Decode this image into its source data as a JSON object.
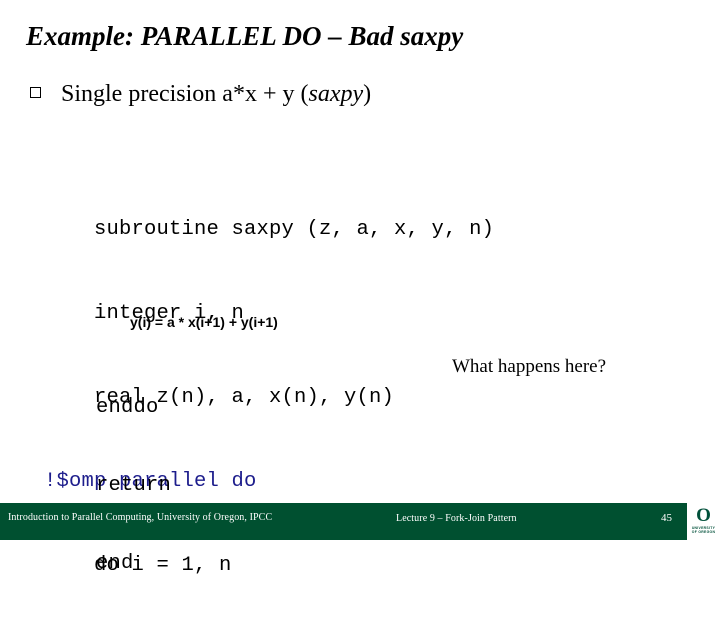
{
  "slide": {
    "title": "Example: PARALLEL DO – Bad saxpy",
    "bullet": {
      "marker": "hollow-square-bullet",
      "text_before": "Single precision a*x + y (",
      "text_italic": "saxpy",
      "text_after": ")"
    },
    "code": {
      "lines": [
        {
          "text": "    subroutine saxpy (z, a, x, y, n)",
          "style": "plain"
        },
        {
          "text": "    integer i, n",
          "style": "plain"
        },
        {
          "text": "    real z(n), a, x(n), y(n)",
          "style": "plain"
        },
        {
          "text": "!$omp parallel do",
          "style": "omp"
        },
        {
          "text": "    do i = 1, n",
          "style": "plain"
        }
      ],
      "inner_formula": "y(i) = a * x(i+1) + y(i+1)",
      "tail_lines": [
        {
          "text": "enddo",
          "style": "plain"
        },
        {
          "text": "return",
          "style": "plain"
        },
        {
          "text": "end",
          "style": "plain"
        }
      ],
      "omp_color": "#1d1d8c"
    },
    "annotation": "What happens here?"
  },
  "footer": {
    "left": "Introduction to Parallel Computing, University of Oregon, IPCC",
    "center": "Lecture 9 – Fork-Join Pattern",
    "page": "45",
    "bar_color": "#005030",
    "logo": {
      "glyph": "O",
      "line1": "UNIVERSITY",
      "line2": "OF OREGON"
    }
  }
}
